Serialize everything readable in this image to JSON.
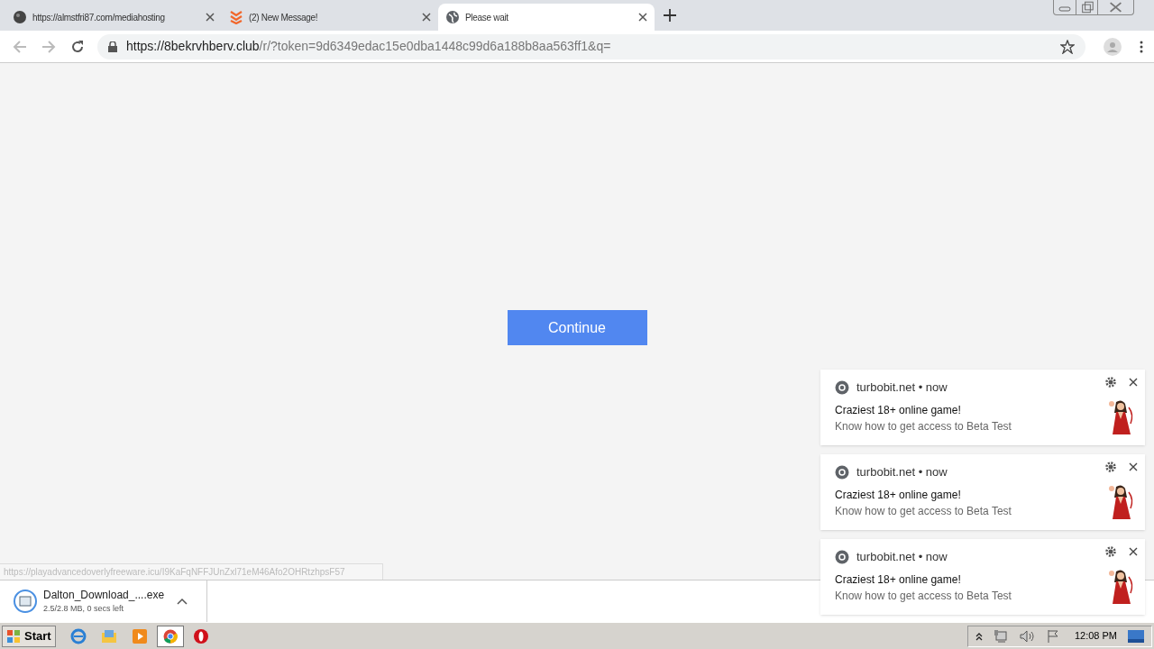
{
  "tabs": [
    {
      "title": "https://almstfri87.com/mediahosting",
      "selected": false
    },
    {
      "title": "(2) New Message!",
      "selected": false
    },
    {
      "title": "Please wait",
      "selected": true
    }
  ],
  "address_bar": {
    "host": "https://8bekrvhberv.club",
    "path": "/r/?token=9d6349edac15e0dba1448c99d6a188b8aa563ff1&q="
  },
  "page": {
    "button": "Continue"
  },
  "status_url": "https://playadvancedoverlyfreeware.icu/I9KaFqNFFJUnZxl71eM46Afo2OHRtzhpsF57",
  "notifications": [
    {
      "source": "turbobit.net • now",
      "title": "Craziest 18+ online game!",
      "body": "Know how to get access to Beta Test"
    },
    {
      "source": "turbobit.net • now",
      "title": "Craziest 18+ online game!",
      "body": "Know how to get access to Beta Test"
    },
    {
      "source": "turbobit.net • now",
      "title": "Craziest 18+ online game!",
      "body": "Know how to get access to Beta Test"
    }
  ],
  "download": {
    "file": "Dalton_Download_....exe",
    "status": "2.5/2.8 MB, 0 secs left"
  },
  "taskbar": {
    "start": "Start",
    "clock": "12:08 PM"
  }
}
